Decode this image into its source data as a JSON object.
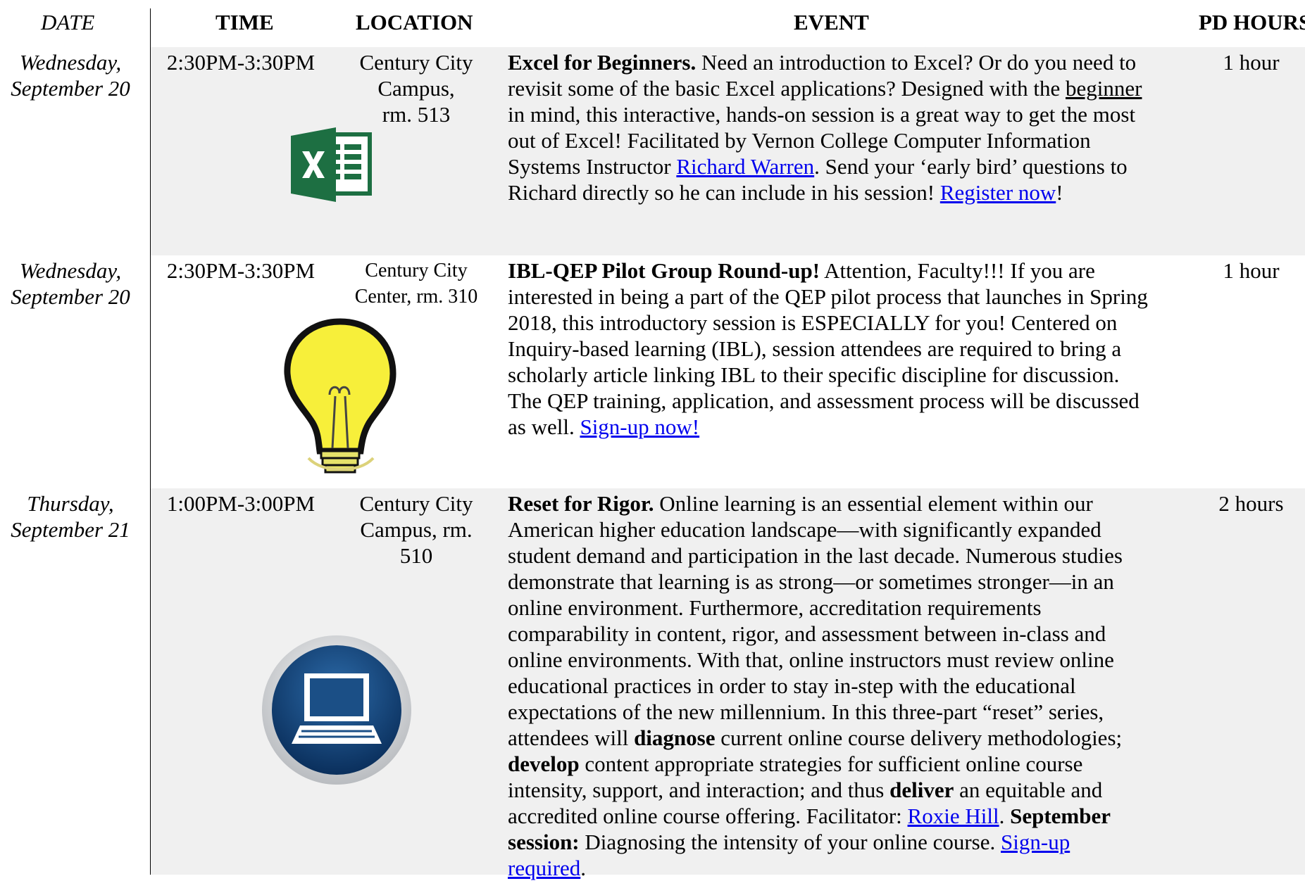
{
  "header": {
    "date": "DATE",
    "time": "TIME",
    "location": "LOCATION",
    "event": "EVENT",
    "pd_hours": "PD HOURS"
  },
  "rows": [
    {
      "date_line1": "Wednesday,",
      "date_line2": "September 20",
      "time": "2:30PM-3:30PM",
      "location_line1": "Century City",
      "location_line2": "Campus,",
      "location_line3": "rm. 513",
      "icon": "excel-logo-icon",
      "event": {
        "title": "Excel for Beginners.",
        "t1": " Need an introduction to Excel? Or do you need to revisit some of the basic Excel applications? Designed with the ",
        "beginner": "beginner",
        "t2": " in mind, this interactive, hands-on session is a great way to get the most out of Excel! Facilitated by Vernon College Computer Information Systems Instructor ",
        "link1": "Richard Warren",
        "t3": ". Send your ‘early bird’ questions to Richard directly so he can include in his session! ",
        "link2": "Register now",
        "t4": "!"
      },
      "hours": "1 hour"
    },
    {
      "date_line1": "Wednesday,",
      "date_line2": "September 20",
      "time": "2:30PM-3:30PM",
      "location_line1": "Century City",
      "location_line2": "Center, rm. 310",
      "icon": "lightbulb-icon",
      "event": {
        "title": "IBL-QEP Pilot Group Round-up!",
        "t1": " Attention, Faculty!!! If you are interested in being a part of the QEP pilot process that launches in Spring 2018, this introductory session is ESPECIALLY for you! Centered on Inquiry-based learning (IBL), session attendees are required to bring a scholarly article linking IBL to their specific discipline for discussion. The QEP training, application, and assessment process will be discussed as well. ",
        "link1": "Sign-up now!"
      },
      "hours": "1 hour"
    },
    {
      "date_line1": "Thursday,",
      "date_line2": "September 21",
      "time": "1:00PM-3:00PM",
      "location_line1": "Century City",
      "location_line2": "Campus, rm.",
      "location_line3": "510",
      "icon": "laptop-icon",
      "event": {
        "title": "Reset for Rigor.",
        "t1": " Online learning is an essential element within our American higher education landscape—with significantly expanded student demand and participation in the last decade. Numerous studies demonstrate that learning is as strong—or sometimes stronger—in an online environment. Furthermore, accreditation requirements comparability in content, rigor, and assessment between in-class and online environments. With that, online instructors must review online educational practices in order to stay in-step with the educational expectations of the new millennium. In this three-part “reset” series, attendees will ",
        "b1": "diagnose",
        "t2": " current online course delivery methodologies; ",
        "b2": "develop",
        "t3": " content appropriate strategies for sufficient online course intensity, support, and interaction; and thus ",
        "b3": "deliver",
        "t4": " an equitable and accredited online course offering. Facilitator: ",
        "link1": "Roxie Hill",
        "t5": ". ",
        "b4": "September session:",
        "t6": " Diagnosing the intensity of your online course. ",
        "link2": "Sign-up required",
        "t7": "."
      },
      "hours": "2 hours"
    }
  ]
}
